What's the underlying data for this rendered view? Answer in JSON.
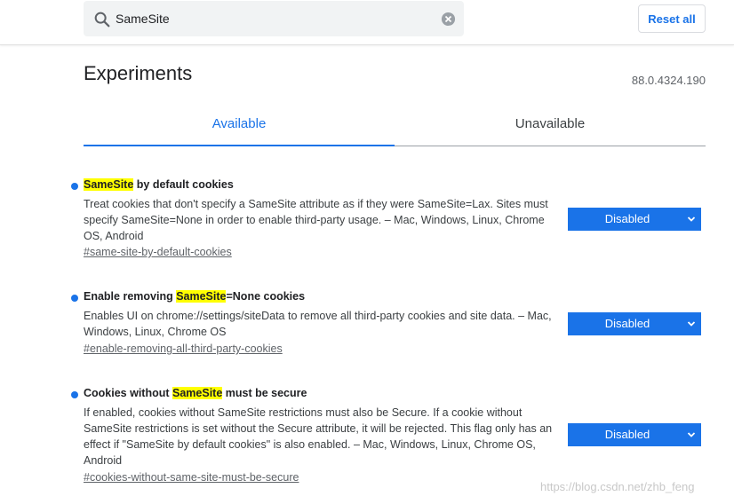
{
  "search": {
    "value": "SameSite"
  },
  "header": {
    "reset_label": "Reset all"
  },
  "page": {
    "title": "Experiments",
    "version": "88.0.4324.190"
  },
  "tabs": [
    {
      "label": "Available"
    },
    {
      "label": "Unavailable"
    }
  ],
  "experiments": [
    {
      "title_pre": "",
      "title_hl": "SameSite",
      "title_post": " by default cookies",
      "description": "Treat cookies that don't specify a SameSite attribute as if they were SameSite=Lax. Sites must specify SameSite=None in order to enable third-party usage. – Mac, Windows, Linux, Chrome OS, Android",
      "link": "#same-site-by-default-cookies",
      "state": "Disabled"
    },
    {
      "title_pre": "Enable removing ",
      "title_hl": "SameSite",
      "title_post": "=None cookies",
      "description": "Enables UI on chrome://settings/siteData to remove all third-party cookies and site data. – Mac, Windows, Linux, Chrome OS",
      "link": "#enable-removing-all-third-party-cookies",
      "state": "Disabled"
    },
    {
      "title_pre": "Cookies without ",
      "title_hl": "SameSite",
      "title_post": " must be secure",
      "description": "If enabled, cookies without SameSite restrictions must also be Secure. If a cookie without SameSite restrictions is set without the Secure attribute, it will be rejected. This flag only has an effect if \"SameSite by default cookies\" is also enabled. – Mac, Windows, Linux, Chrome OS, Android",
      "link": "#cookies-without-same-site-must-be-secure",
      "state": "Disabled"
    }
  ],
  "watermark": "https://blog.csdn.net/zhb_feng",
  "colors": {
    "accent": "#1a73e8",
    "highlight": "#ffff00"
  },
  "icons": {
    "search": "search-icon",
    "clear": "clear-icon",
    "dropdown": "chevron-down-icon"
  }
}
